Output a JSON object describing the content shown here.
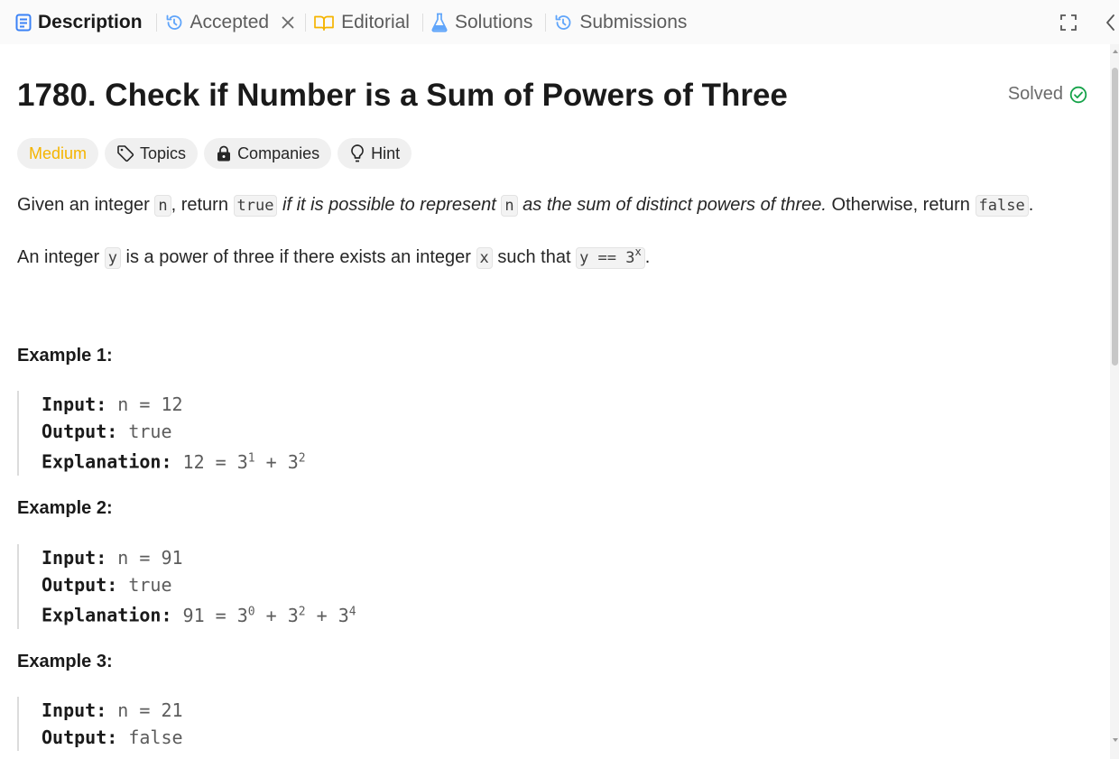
{
  "tabs": [
    {
      "label": "Description",
      "icon": "description-icon",
      "active": true
    },
    {
      "label": "Accepted",
      "icon": "history-icon",
      "closable": true
    },
    {
      "label": "Editorial",
      "icon": "book-icon"
    },
    {
      "label": "Solutions",
      "icon": "flask-icon"
    },
    {
      "label": "Submissions",
      "icon": "history-icon"
    }
  ],
  "problem": {
    "title": "1780. Check if Number is a Sum of Powers of Three",
    "status": "Solved",
    "difficulty": "Medium",
    "chips": [
      "Topics",
      "Companies",
      "Hint"
    ]
  },
  "description": {
    "p1": {
      "t1": "Given an integer ",
      "c1": "n",
      "t2": ", return ",
      "c2": "true",
      "e1": " if it is possible to represent ",
      "c3": "n",
      "e2": " as the sum of distinct powers of three.",
      "t3": " Otherwise, return ",
      "c4": "false",
      "t4": "."
    },
    "p2": {
      "t1": "An integer ",
      "c1": "y",
      "t2": " is a power of three if there exists an integer ",
      "c2": "x",
      "t3": " such that ",
      "c3": "y == 3",
      "c3sup": "x",
      "t4": "."
    }
  },
  "examples": [
    {
      "title": "Example 1:",
      "input_label": "Input:",
      "input": "n = 12",
      "output_label": "Output:",
      "output": "true",
      "explanation_label": "Explanation:",
      "explanation": [
        {
          "text": "12 = 3",
          "sup": "1"
        },
        {
          "text": " + 3",
          "sup": "2"
        }
      ]
    },
    {
      "title": "Example 2:",
      "input_label": "Input:",
      "input": "n = 91",
      "output_label": "Output:",
      "output": "true",
      "explanation_label": "Explanation:",
      "explanation": [
        {
          "text": "91 = 3",
          "sup": "0"
        },
        {
          "text": " + 3",
          "sup": "2"
        },
        {
          "text": " + 3",
          "sup": "4"
        }
      ]
    },
    {
      "title": "Example 3:",
      "input_label": "Input:",
      "input": "n = 21",
      "output_label": "Output:",
      "output": "false"
    }
  ],
  "colors": {
    "accent_blue": "#3b82f6",
    "medium": "#f5b400",
    "solved_green": "#16a34a"
  }
}
